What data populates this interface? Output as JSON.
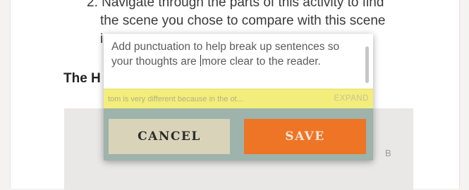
{
  "instructions": {
    "line1": "2. Navigate through the parts of this activity to find",
    "line2": "the scene you chose to compare with this scene",
    "line3": "ir"
  },
  "section_heading": "The H",
  "background_letter": "B",
  "popup": {
    "textarea_before_cursor": "Add punctuation to help break up sentences so your thoughts are ",
    "textarea_after_cursor": "more clear to the reader.",
    "response_preview": "tom is very different because in the ot...",
    "expand_label": "EXPAND",
    "cancel_label": "CANCEL",
    "save_label": "SAVE"
  },
  "colors": {
    "save": "#ee7426",
    "cancel": "#d9d3b9",
    "button_area": "#9eb3ab",
    "highlight_strip": "#f3ee7c"
  }
}
